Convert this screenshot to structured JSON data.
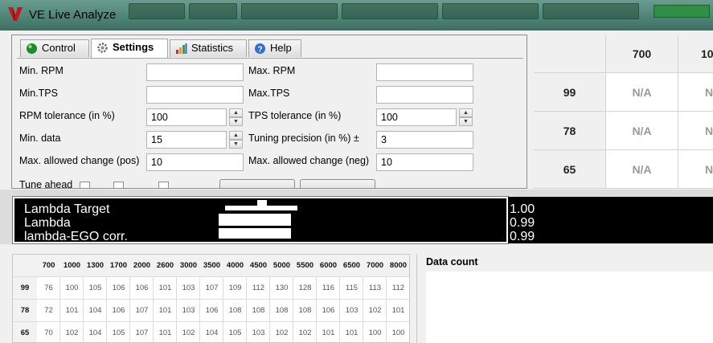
{
  "window": {
    "title": "VE Live Analyze"
  },
  "tabs": [
    {
      "label": "Control",
      "icon": "green-ball-icon"
    },
    {
      "label": "Settings",
      "icon": "gear-icon"
    },
    {
      "label": "Statistics",
      "icon": "bar-chart-icon"
    },
    {
      "label": "Help",
      "icon": "help-icon"
    }
  ],
  "settings": {
    "min_rpm": {
      "label": "Min. RPM",
      "value": ""
    },
    "max_rpm": {
      "label": "Max. RPM",
      "value": ""
    },
    "min_tps": {
      "label": "Min.TPS",
      "value": ""
    },
    "max_tps": {
      "label": "Max.TPS",
      "value": ""
    },
    "rpm_tolerance": {
      "label": "RPM tolerance (in %)",
      "value": "100"
    },
    "tps_tolerance": {
      "label": "TPS tolerance (in %)",
      "value": "100"
    },
    "min_data": {
      "label": "Min. data",
      "value": "15"
    },
    "tuning_precision": {
      "label": "Tuning precision (in %) ±",
      "value": "3"
    },
    "max_change_pos": {
      "label": "Max. allowed change (pos)",
      "value": "10"
    },
    "max_change_neg": {
      "label": "Max. allowed change (neg)",
      "value": "10"
    },
    "tune_ahead": {
      "label": "Tune ahead"
    }
  },
  "big_table": {
    "columns": [
      "700",
      "10"
    ],
    "rows": [
      {
        "tps": "99",
        "cells": [
          "N/A",
          "N"
        ]
      },
      {
        "tps": "78",
        "cells": [
          "N/A",
          "N"
        ]
      },
      {
        "tps": "65",
        "cells": [
          "N/A",
          "N"
        ]
      }
    ]
  },
  "gauges": [
    {
      "label": "Lambda Target",
      "value": "1.00"
    },
    {
      "label": "Lambda",
      "value": "0.99"
    },
    {
      "label": "lambda-EGO corr.",
      "value": "0.99"
    }
  ],
  "ve_table": {
    "columns": [
      "700",
      "1000",
      "1300",
      "1700",
      "2000",
      "2600",
      "3000",
      "3500",
      "4000",
      "4500",
      "5000",
      "5500",
      "6000",
      "6500",
      "7000",
      "8000"
    ],
    "rows": [
      {
        "tps": "99",
        "values": [
          "76",
          "100",
          "105",
          "106",
          "106",
          "101",
          "103",
          "107",
          "109",
          "112",
          "130",
          "128",
          "116",
          "115",
          "113",
          "112"
        ]
      },
      {
        "tps": "78",
        "values": [
          "72",
          "101",
          "104",
          "106",
          "107",
          "101",
          "103",
          "106",
          "108",
          "108",
          "108",
          "108",
          "106",
          "103",
          "102",
          "101"
        ]
      },
      {
        "tps": "65",
        "values": [
          "70",
          "102",
          "104",
          "105",
          "107",
          "101",
          "102",
          "104",
          "105",
          "103",
          "102",
          "102",
          "101",
          "101",
          "100",
          "100"
        ]
      }
    ]
  },
  "data_count": {
    "label": "Data count"
  }
}
